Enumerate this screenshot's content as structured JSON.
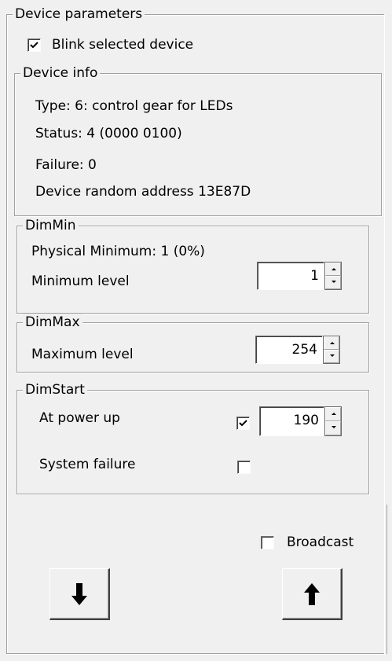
{
  "device_parameters": {
    "title": "Device parameters",
    "blink_selected": {
      "label": "Blink selected device",
      "checked": true
    }
  },
  "device_info": {
    "title": "Device info",
    "type": "Type: 6: control gear for LEDs",
    "status": "Status: 4 (0000 0100)",
    "failure": "Failure: 0",
    "random_address": "Device random address 13E87D"
  },
  "dim_min": {
    "title": "DimMin",
    "physical_minimum": "Physical Minimum: 1 (0%)",
    "minimum_level_label": "Minimum level",
    "minimum_level_value": "1"
  },
  "dim_max": {
    "title": "DimMax",
    "maximum_level_label": "Maximum level",
    "maximum_level_value": "254"
  },
  "dim_start": {
    "title": "DimStart",
    "at_power_up_label": "At power up",
    "at_power_up_checked": true,
    "at_power_up_value": "190",
    "system_failure_label": "System failure",
    "system_failure_checked": false
  },
  "broadcast": {
    "label": "Broadcast",
    "checked": false
  },
  "buttons": {
    "download_icon": "down-arrow-icon",
    "upload_icon": "up-arrow-icon"
  }
}
